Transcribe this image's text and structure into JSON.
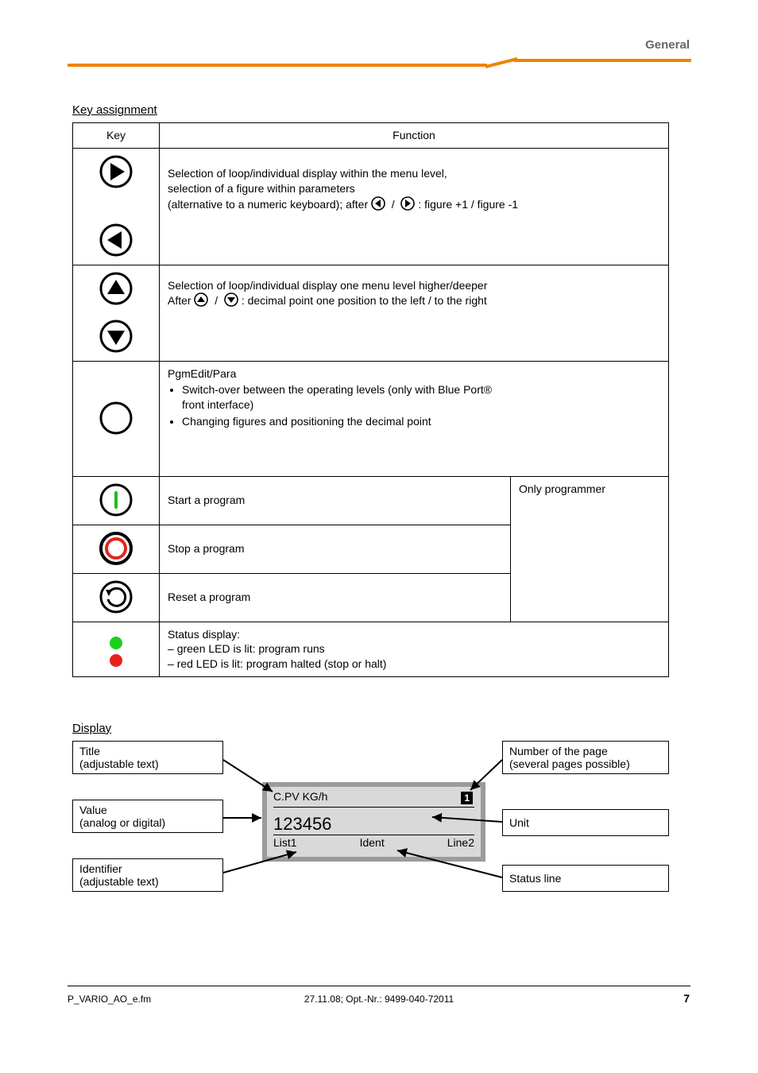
{
  "header": {
    "chapter": "General"
  },
  "section_keys_title": "Key assignment",
  "section_display_title": "Display",
  "table": {
    "header": {
      "c1": "Key",
      "c2": "Function"
    },
    "rows": {
      "arrows_lr": {
        "line1": "Selection of loop/individual display within the menu level,",
        "line2": "selection of a figure within parameters",
        "line3_prefix": "(alternative to a numeric keyboard); after ",
        "line3_suffix": ": figure +1 / figure -1"
      },
      "arrows_ud": {
        "line1": "Selection of loop/individual display one menu level higher/deeper",
        "line2_prefix": "After ",
        "line2_suffix": ": decimal point one position to the left / to the right"
      },
      "pgm": {
        "label": "PgmEdit/Para",
        "line1": "Switch-over between the operating levels (only with Blue Port®",
        "line2": "front interface)",
        "note": "Changing figures and positioning the decimal point"
      },
      "start": {
        "text": "Start a program"
      },
      "stop": {
        "text": "Stop a program"
      },
      "reset": {
        "text": "Reset a program"
      },
      "note_right": "Only programmer",
      "leds": {
        "title": "Status display:",
        "green": "green LED is lit: program runs",
        "red": "red LED is lit: program halted (stop or halt)"
      }
    }
  },
  "callouts": {
    "title": {
      "l1": "Title",
      "l2": "(adjustable text)"
    },
    "value": {
      "l1": "Value",
      "l2": "(analog or digital)"
    },
    "ident": {
      "l1": "Identifier",
      "l2": "(adjustable text)"
    },
    "number": {
      "l1": "Number of the page",
      "l2": "(several pages possible)"
    },
    "unit": {
      "text": "Unit"
    },
    "status": {
      "text": "Status line"
    }
  },
  "lcd": {
    "title": "C.PV KG/h",
    "chip": "1",
    "value": "123456",
    "status_left": "List1",
    "status_mid": "Ident",
    "status_right": "Line2"
  },
  "footer": {
    "left": "P_VARIO_AO_e.fm",
    "center": "27.11.08; Opt.-Nr.: 9499-040-72011",
    "right": "7"
  }
}
